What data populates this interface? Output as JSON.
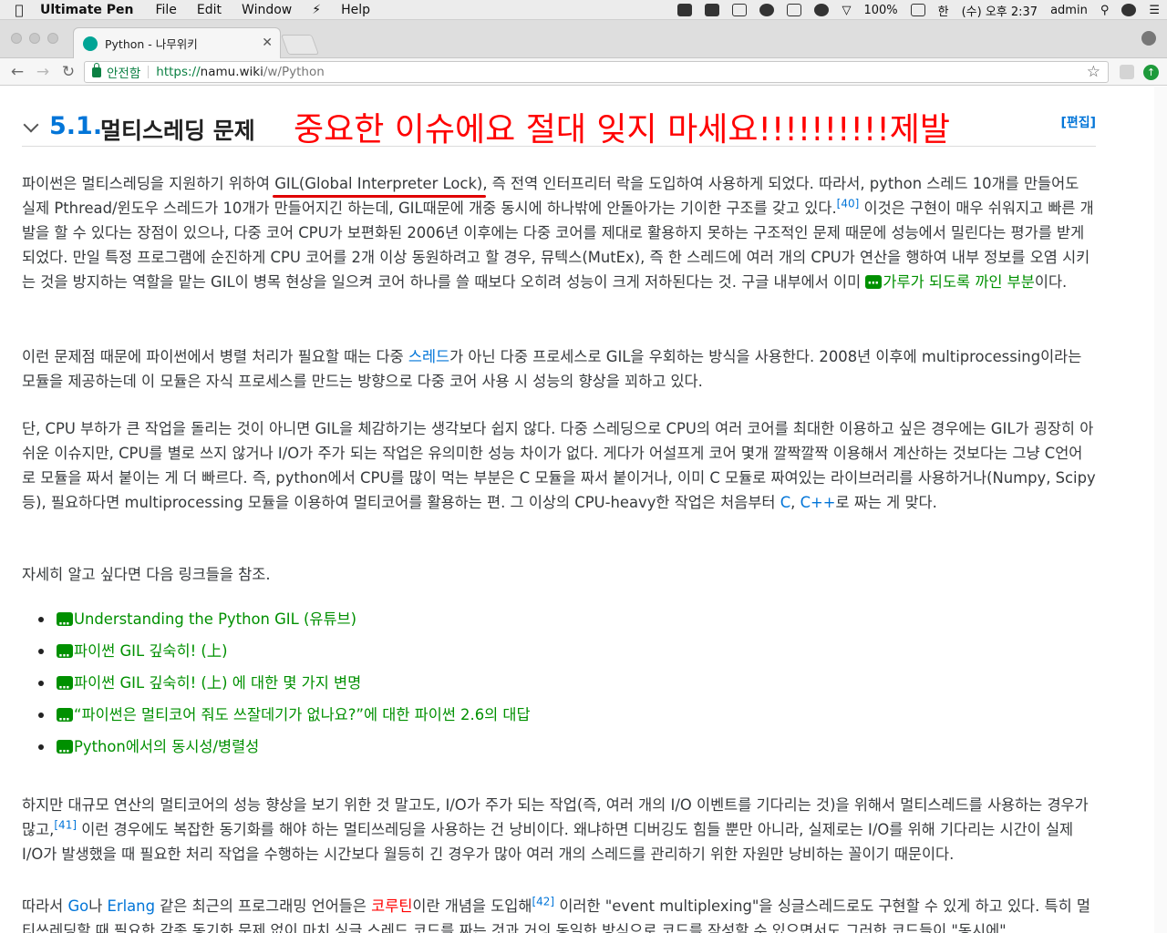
{
  "menubar": {
    "app_name": "Ultimate Pen",
    "items": [
      "File",
      "Edit",
      "Window",
      "Help"
    ],
    "battery": "100%",
    "ime": "한",
    "clock": "(수) 오후 2:37",
    "user": "admin"
  },
  "browser": {
    "tab_title": "Python - 나무위키",
    "secure_label": "안전함",
    "url_scheme": "https://",
    "url_host": "namu.wiki",
    "url_path": "/w/Python"
  },
  "section": {
    "number": "5.1.",
    "title": "멀티스레딩 문제",
    "annotation": "중요한 이슈에요 절대 잊지 마세요!!!!!!!!!!제발",
    "edit_label": "[편집]"
  },
  "p1": {
    "t1": "파이썬은 멀티스레딩을 지원하기 위하여 ",
    "gil": "GIL(Global Interpreter Lock)",
    "t2": ", 즉 전역 인터프리터 락을 도입하여 사용하게 되었다. 따라서, python 스레드 10개를 만들어도 실제 Pthread/윈도우 스레드가 10개가 만들어지긴 하는데, GIL때문에 개중 동시에 하나밖에 안돌아가는 기이한 구조를 갖고 있다.",
    "fn": "[40]",
    "t3": " 이것은 구현이 매우 쉬워지고 빠른 개발을 할 수 있다는 장점이 있으나, 다중 코어 CPU가 보편화된 2006년 이후에는 다중 코어를 제대로 활용하지 못하는 구조적인 문제 때문에 성능에서 밀린다는 평가를 받게 되었다. 만일 특정 프로그램에 순진하게 CPU 코어를 2개 이상 동원하려고 할 경우, 뮤텍스(MutEx), 즉 한 스레드에 여러 개의 CPU가 연산을 행하여 내부 정보를 오염 시키는 것을 방지하는 역할을 맡는 GIL이 병목 현상을 일으켜 코어 하나를 쓸 때보다 오히려 성능이 크게 저하된다는 것. 구글 내부에서 이미 ",
    "ext_link": "가루가 되도록 까인 부분",
    "t4": "이다."
  },
  "p2": {
    "t1": "이런 문제점 때문에 파이썬에서 병렬 처리가 필요할 때는 다중 ",
    "link": "스레드",
    "t2": "가 아닌 다중 프로세스로 GIL을 우회하는 방식을 사용한다. 2008년 이후에 multiprocessing이라는 모듈을 제공하는데 이 모듈은 자식 프로세스를 만드는 방향으로 다중 코어 사용 시 성능의 향상을 꾀하고 있다."
  },
  "p3": {
    "t1": "단, CPU 부하가 큰 작업을 돌리는 것이 아니면 GIL을 체감하기는 생각보다 쉽지 않다. 다중 스레딩으로 CPU의 여러 코어를 최대한 이용하고 싶은 경우에는 GIL가 굉장히 아쉬운 이슈지만, CPU를 별로 쓰지 않거나 I/O가 주가 되는 작업은 유의미한 성능 차이가 없다. 게다가 어설프게 코어 몇개 깔짝깔짝 이용해서 계산하는 것보다는 그냥 C언어로 모듈을 짜서 붙이는 게 더 빠르다. 즉, python에서 CPU를 많이 먹는 부분은 C 모듈을 짜서 붙이거나, 이미 C 모듈로 짜여있는 라이브러리를 사용하거나(Numpy, Scipy 등), 필요하다면 multiprocessing 모듈을 이용하여 멀티코어를 활용하는 편. 그 이상의 CPU-heavy한 작업은 처음부터 ",
    "link_c": "C",
    "comma": ", ",
    "link_cpp": "C++",
    "t2": "로 짜는 게 맞다."
  },
  "p4": {
    "text": "자세히 알고 싶다면 다음 링크들을 참조."
  },
  "links": [
    "Understanding the Python GIL (유튜브)",
    "파이썬 GIL 깊숙히! (上)",
    "파이썬 GIL 깊숙히! (上) 에 대한 몇 가지 변명",
    "“파이썬은 멀티코어 줘도 쓰잘데기가 없나요?”에 대한 파이썬 2.6의 대답",
    "Python에서의 동시성/병렬성"
  ],
  "p5": {
    "t1": "하지만 대규모 연산의 멀티코어의 성능 향상을 보기 위한 것 말고도, I/O가 주가 되는 작업(즉, 여러 개의 I/O 이벤트를 기다리는 것)을 위해서 멀티스레드를 사용하는 경우가 많고,",
    "fn": "[41]",
    "t2": " 이런 경우에도 복잡한 동기화를 해야 하는 멀티쓰레딩을 사용하는 건 낭비이다. 왜냐하면 디버깅도 힘들 뿐만 아니라, 실제로는 I/O를 위해 기다리는 시간이 실제 I/O가 발생했을 때 필요한 처리 작업을 수행하는 시간보다 월등히 긴 경우가 많아 여러 개의 스레드를 관리하기 위한 자원만 낭비하는 꼴이기 때문이다."
  },
  "p6": {
    "t1": "따라서 ",
    "go": "Go",
    "na": "나 ",
    "erlang": "Erlang",
    "t2": " 같은 최근의 프로그래밍 언어들은 ",
    "coroutine": "코루틴",
    "t3": "이란 개념을 도입해",
    "fn": "[42]",
    "t4": " 이러한 \"event multiplexing\"을 싱글스레드로도 구현할 수 있게 하고 있다. 특히 멀티쓰레딩할 때 필요한 각종 동기화 문제 없이 마치 싱글 스레드 코드를 짜는 것과 거의 동일한 방식으로 코드를 작성할 수 있으면서도 그러한 코드들이 \"동시에\""
  }
}
